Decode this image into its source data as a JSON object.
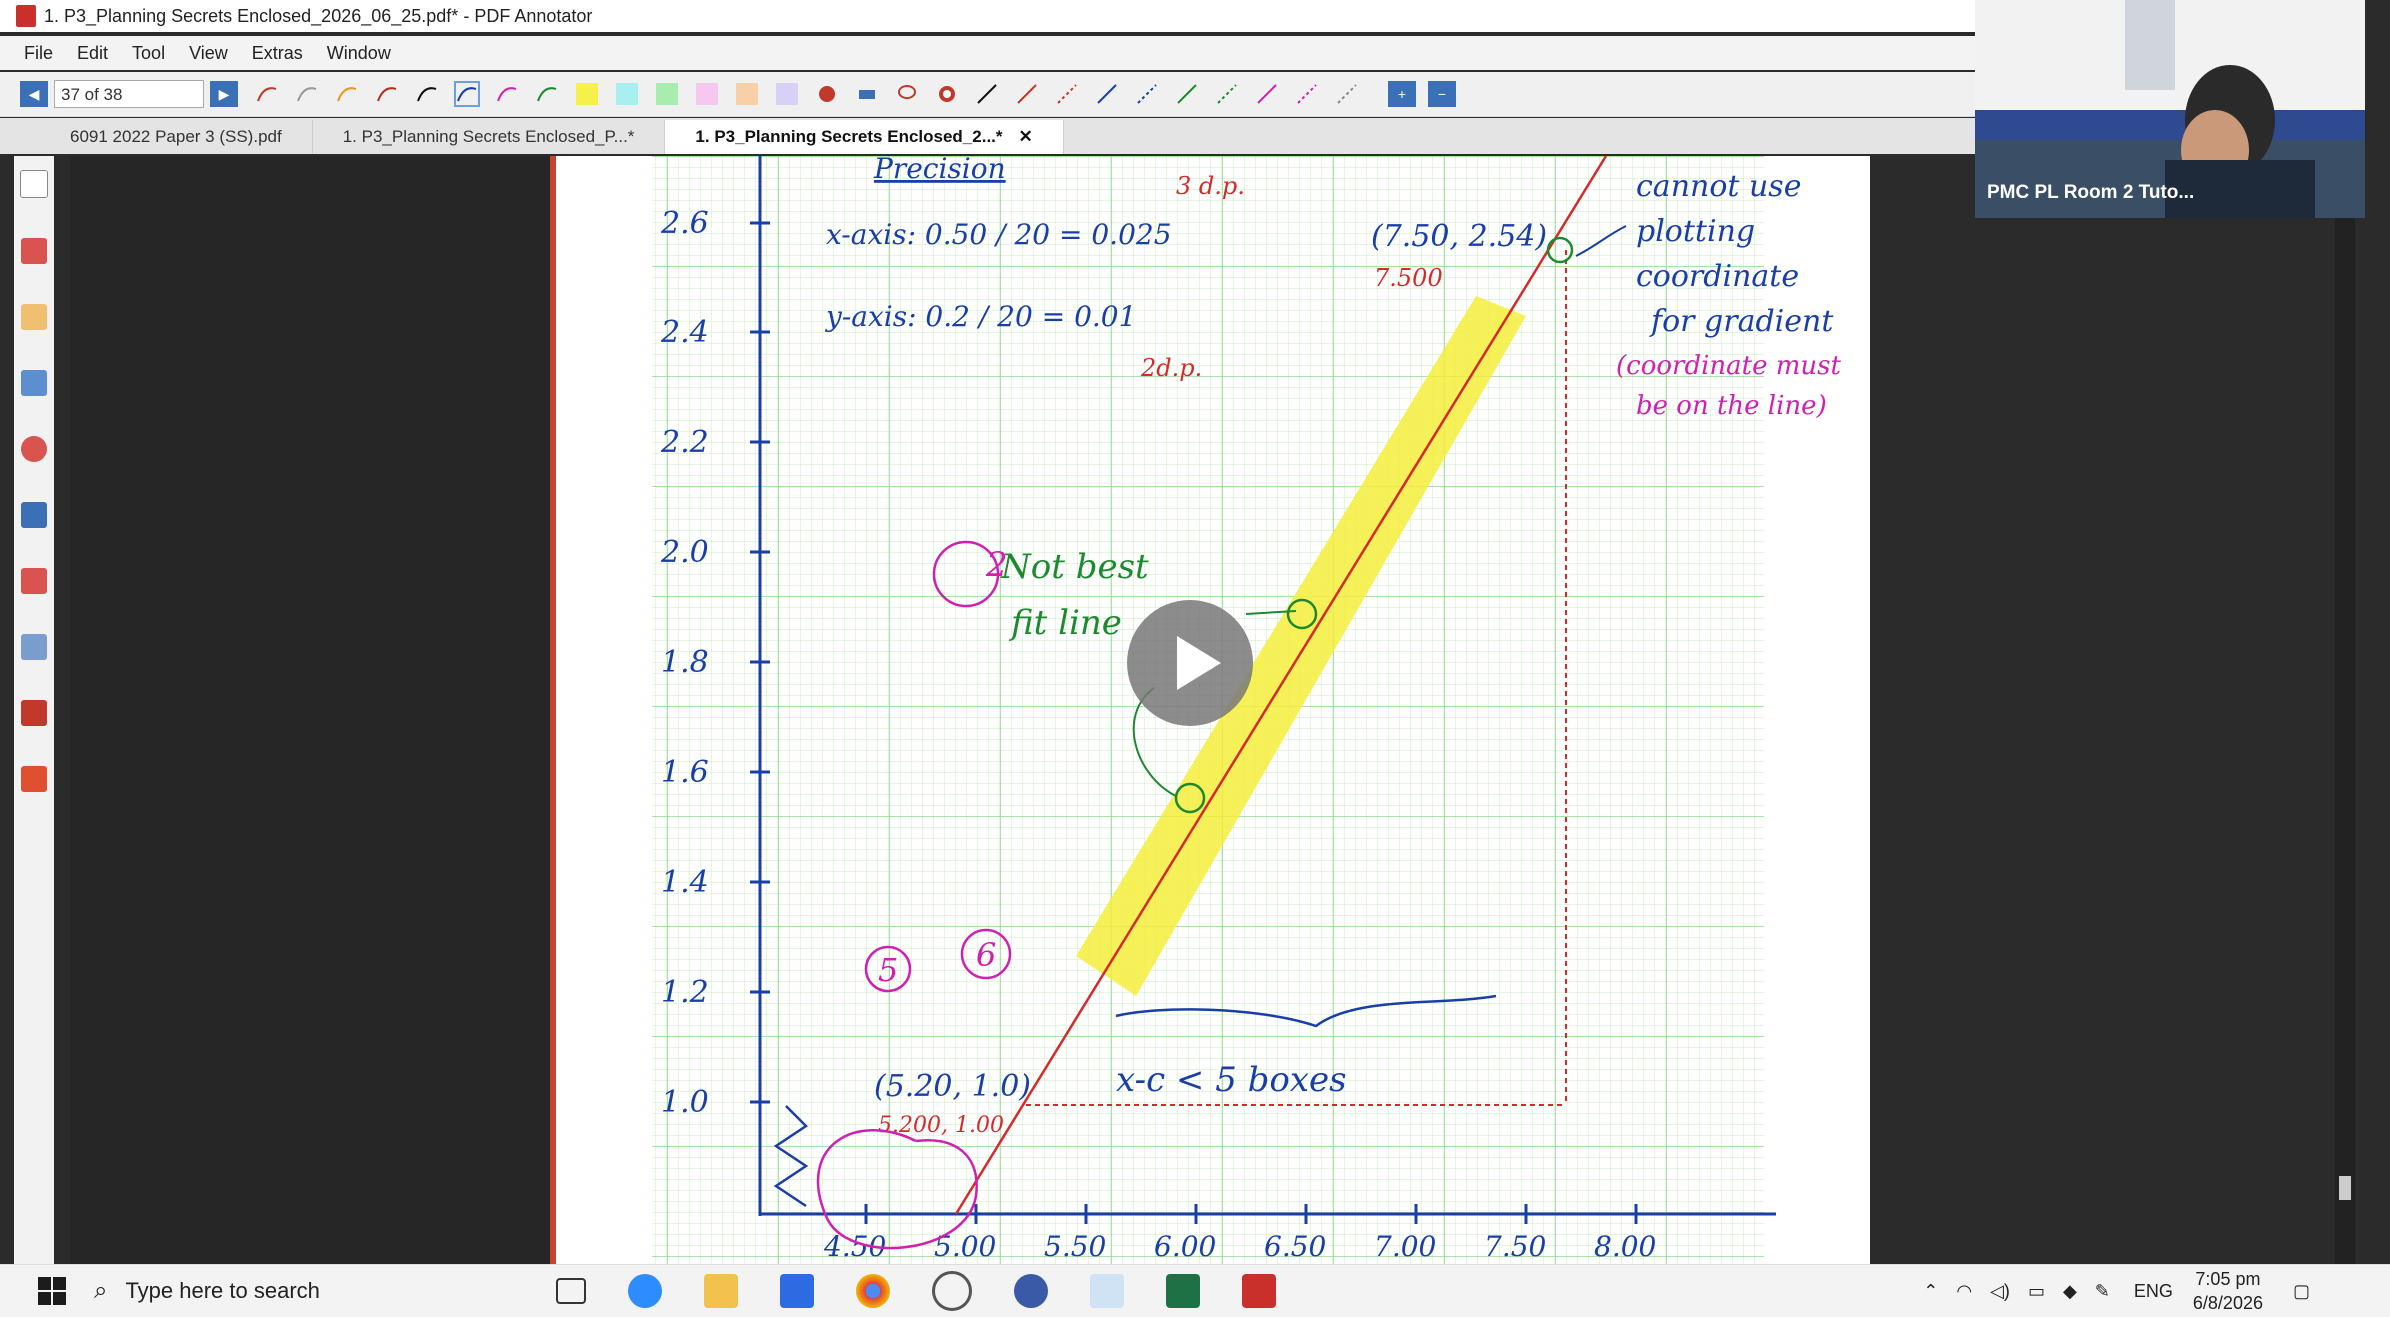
{
  "window": {
    "title": "1. P3_Planning Secrets Enclosed_2026_06_25.pdf* - PDF Annotator"
  },
  "menu": [
    "File",
    "Edit",
    "Tool",
    "View",
    "Extras",
    "Window"
  ],
  "toolbar": {
    "page_indicator": "37 of 38"
  },
  "tabs": [
    {
      "label": "6091 2022 Paper 3 (SS).pdf"
    },
    {
      "label": "1. P3_Planning Secrets Enclosed_P...*"
    },
    {
      "label": "1. P3_Planning Secrets Enclosed_2...*",
      "close": "✕"
    }
  ],
  "webcam": {
    "label": "PMC PL Room 2 Tuto..."
  },
  "annotation": {
    "heading": "Precision",
    "x_axis_note": "x-axis: 0.50 / 20 = 0.025",
    "x_dp": "3 d.p.",
    "y_axis_note": "y-axis: 0.2 / 20 = 0.01",
    "y_dp": "2d.p.",
    "top_point": "(7.50, 2.54)",
    "top_point_fix": "7.500",
    "side_note": [
      "cannot use",
      "plotting",
      "coordinate",
      "for gradient"
    ],
    "side_note_pink": [
      "(coordinate must",
      "be on the line)"
    ],
    "not_best_fit": [
      "Not best",
      "fit line"
    ],
    "circle_2": "2",
    "circle_5": "5",
    "circle_6": "6",
    "bottom_point": "(5.20, 1.0)",
    "bottom_point_fix": "5.200, 1.00",
    "boxes_note": "x-c  < 5 boxes"
  },
  "graph": {
    "y_ticks": [
      "2.6",
      "2.4",
      "2.2",
      "2.0",
      "1.8",
      "1.6",
      "1.4",
      "1.2",
      "1.0"
    ],
    "x_ticks": [
      "4.50",
      "5.00",
      "5.50",
      "6.00",
      "6.50",
      "7.00",
      "7.50",
      "8.00"
    ]
  },
  "taskbar": {
    "search_placeholder": "Type here to search",
    "language": "ENG",
    "time": "7:05 pm",
    "date": "6/8/2026"
  }
}
